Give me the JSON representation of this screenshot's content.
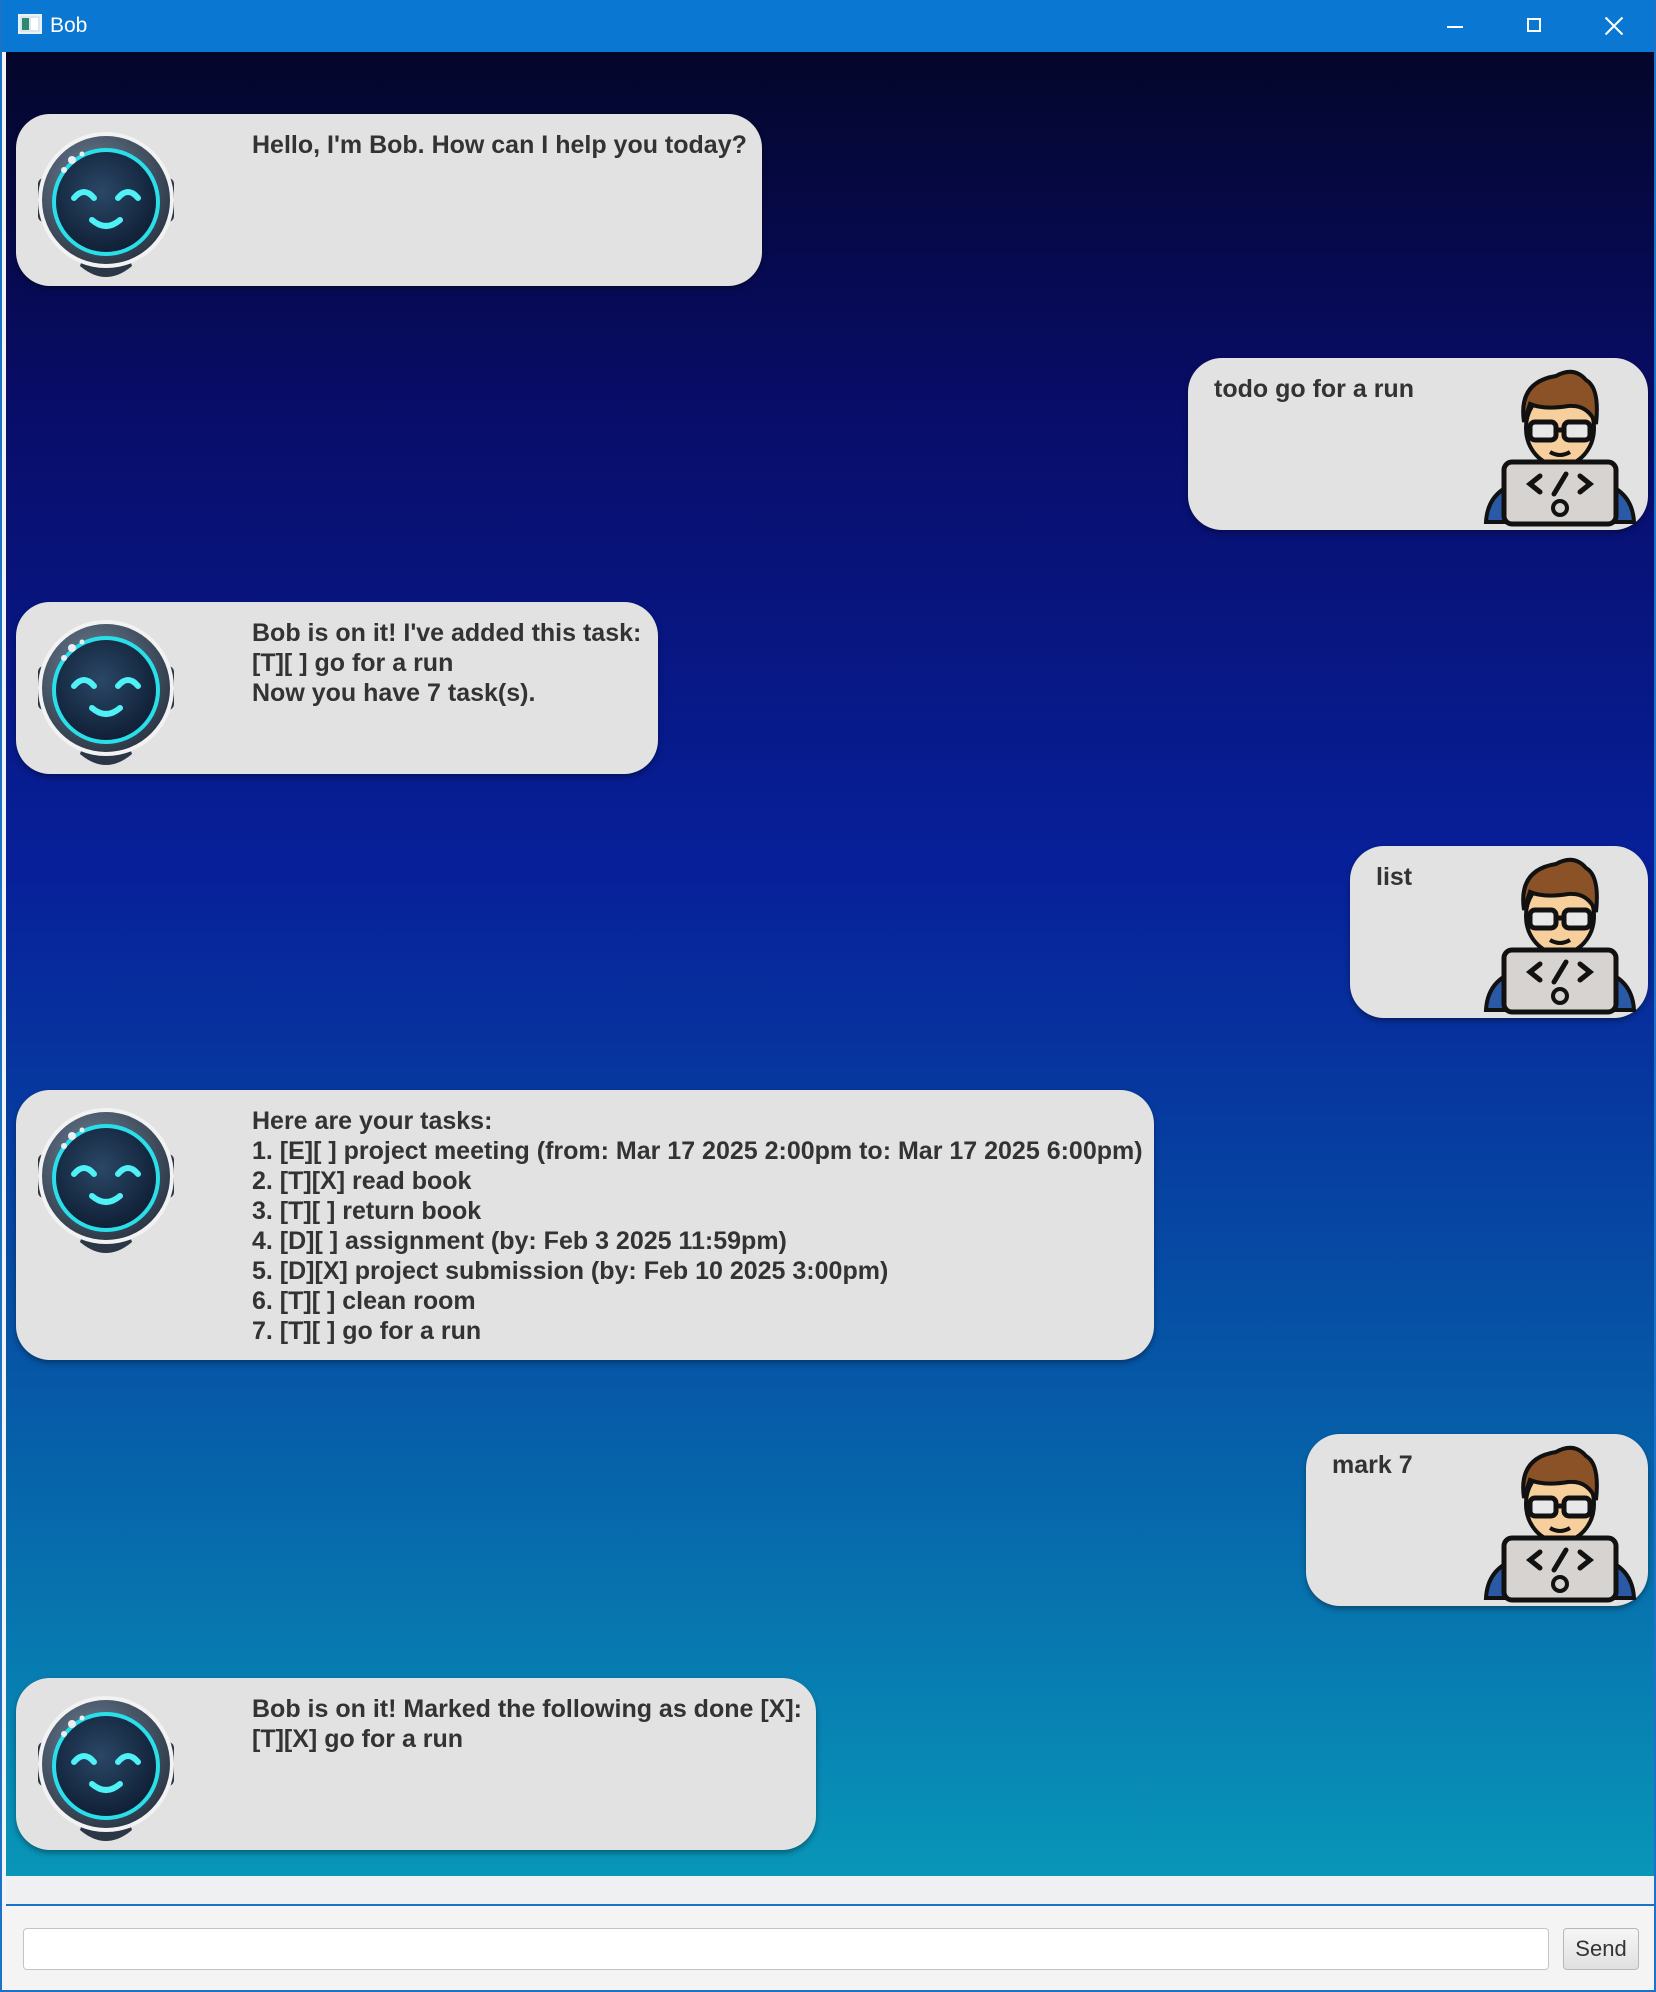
{
  "window": {
    "title": "Bob",
    "icon": "app-window-icon",
    "controls": {
      "minimize_icon": "minimize-icon",
      "maximize_icon": "maximize-icon",
      "close_icon": "close-icon"
    }
  },
  "colors": {
    "titlebar": "#0a78d2",
    "bubble": "#e2e2e2",
    "bubble_text": "#333333",
    "gradient_top": "#04062a",
    "gradient_bottom": "#0896b8"
  },
  "conversation": [
    {
      "sender": "bot",
      "avatar": "robot-avatar-icon",
      "text": "Hello, I'm Bob. How can I help you today?"
    },
    {
      "sender": "user",
      "avatar": "programmer-avatar-icon",
      "text": "todo go for a run"
    },
    {
      "sender": "bot",
      "avatar": "robot-avatar-icon",
      "text": "Bob is on it! I've added this task:\n[T][ ] go for a run\nNow you have 7 task(s)."
    },
    {
      "sender": "user",
      "avatar": "programmer-avatar-icon",
      "text": "list"
    },
    {
      "sender": "bot",
      "avatar": "robot-avatar-icon",
      "text": "Here are your tasks:\n1. [E][ ] project meeting (from: Mar 17 2025 2:00pm to: Mar 17 2025 6:00pm)\n2. [T][X] read book\n3. [T][ ] return book\n4. [D][ ] assignment (by: Feb 3 2025 11:59pm)\n5. [D][X] project submission (by: Feb 10 2025 3:00pm)\n6. [T][ ] clean room\n7. [T][ ] go for a run"
    },
    {
      "sender": "user",
      "avatar": "programmer-avatar-icon",
      "text": "mark 7"
    },
    {
      "sender": "bot",
      "avatar": "robot-avatar-icon",
      "text": "Bob is on it! Marked the following as done [X]:\n[T][X] go for a run"
    }
  ],
  "input": {
    "value": "",
    "placeholder": ""
  },
  "send_button": {
    "label": "Send"
  }
}
